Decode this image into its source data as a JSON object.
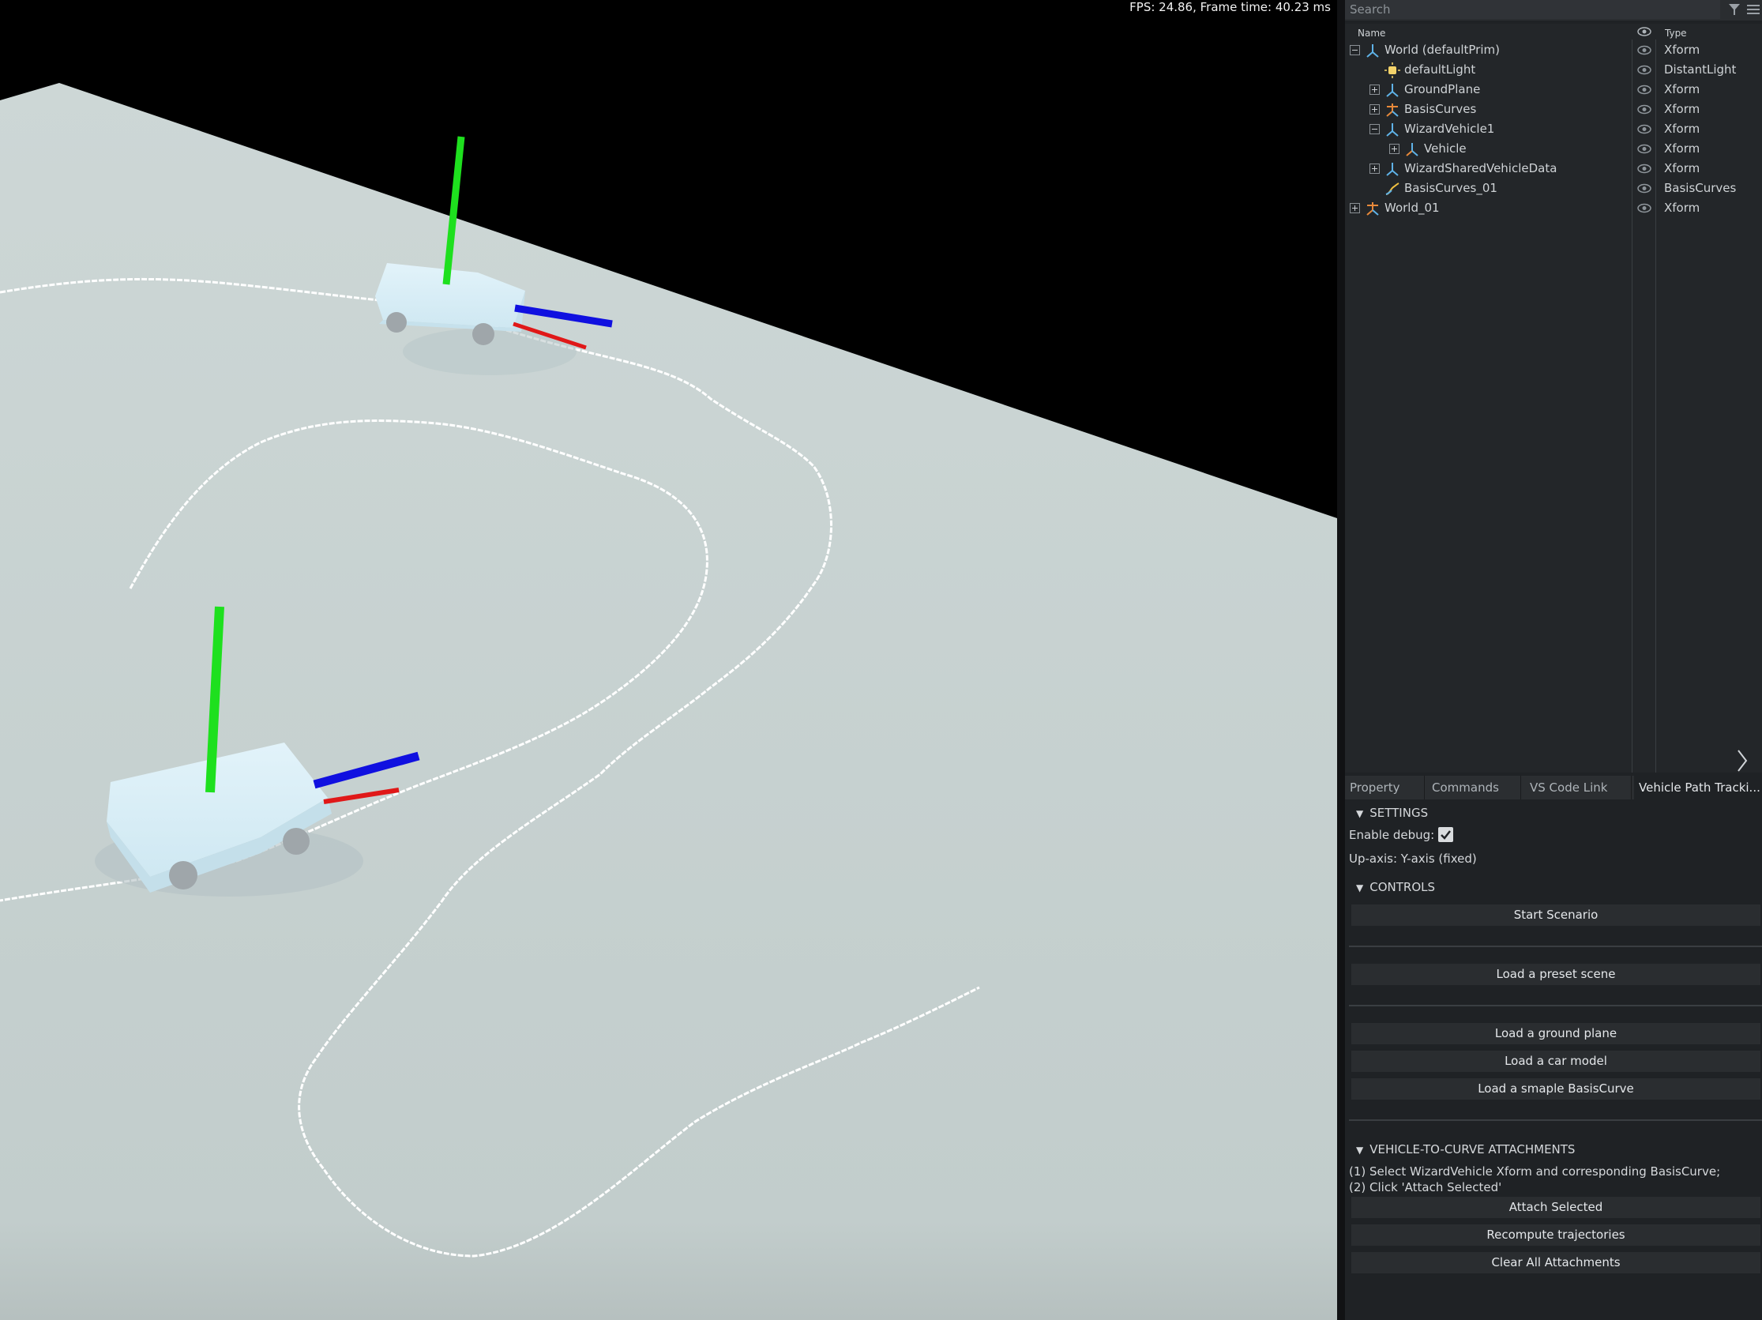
{
  "viewport": {
    "stats": "FPS: 24.86, Frame time: 40.23 ms",
    "colors": {
      "ground": "#c5d0cf",
      "curve": "#ffffff",
      "vehicle_body": "#cde8f3",
      "axis_up": "#1ee01e",
      "axis_forward": "#1010e0",
      "axis_side": "#e01818"
    }
  },
  "stage": {
    "search_placeholder": "Search",
    "columns": {
      "name": "Name",
      "type": "Type"
    },
    "rows": [
      {
        "name": "World (defaultPrim)",
        "type": "Xform",
        "icon": "xform-icon",
        "toggle": "minus"
      },
      {
        "name": "defaultLight",
        "type": "DistantLight",
        "icon": "light-icon",
        "toggle": "none"
      },
      {
        "name": "GroundPlane",
        "type": "Xform",
        "icon": "xform-icon",
        "toggle": "plus"
      },
      {
        "name": "BasisCurves",
        "type": "Xform",
        "icon": "xform-orange-icon",
        "toggle": "plus"
      },
      {
        "name": "WizardVehicle1",
        "type": "Xform",
        "icon": "xform-icon",
        "toggle": "minus"
      },
      {
        "name": "Vehicle",
        "type": "Xform",
        "icon": "xform-icon",
        "toggle": "plus"
      },
      {
        "name": "WizardSharedVehicleData",
        "type": "Xform",
        "icon": "xform-icon",
        "toggle": "plus"
      },
      {
        "name": "BasisCurves_01",
        "type": "BasisCurves",
        "icon": "curve-icon",
        "toggle": "none"
      },
      {
        "name": "World_01",
        "type": "Xform",
        "icon": "xform-orange-icon",
        "toggle": "plus"
      }
    ]
  },
  "tabs": [
    {
      "label": "Property",
      "active": false
    },
    {
      "label": "Commands",
      "active": false
    },
    {
      "label": "VS Code Link",
      "active": false
    },
    {
      "label": "Vehicle Path Tracki...",
      "active": true
    }
  ],
  "extension": {
    "settings": {
      "title": "SETTINGS",
      "enable_debug_label": "Enable debug:",
      "enable_debug": true,
      "up_axis": "Up-axis: Y-axis (fixed)"
    },
    "controls": {
      "title": "CONTROLS",
      "start_scenario": "Start Scenario",
      "load_preset": "Load a preset scene",
      "load_ground": "Load a ground plane",
      "load_car": "Load a car model",
      "load_curve": "Load a smaple BasisCurve"
    },
    "attachments": {
      "title": "VEHICLE-TO-CURVE ATTACHMENTS",
      "instruction_1": "(1) Select WizardVehicle Xform and corresponding BasisCurve;",
      "instruction_2": "(2) Click 'Attach Selected'",
      "attach": "Attach Selected",
      "recompute": "Recompute trajectories",
      "clear": "Clear All Attachments"
    }
  }
}
